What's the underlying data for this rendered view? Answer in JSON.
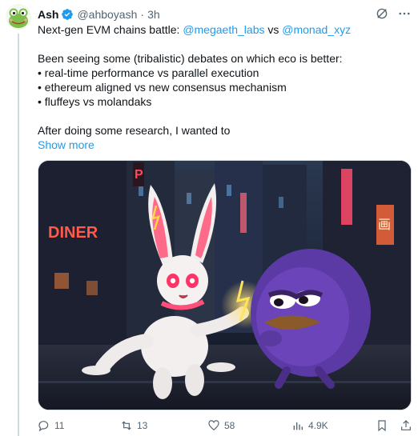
{
  "author": {
    "name": "Ash",
    "handle": "@ahboyash",
    "separator": "·",
    "time": "3h"
  },
  "tweet": {
    "line1_prefix": "Next-gen EVM chains battle: ",
    "mention1": "@megaeth_labs",
    "line1_mid": " vs ",
    "mention2": "@monad_xyz",
    "line2": "Been seeing some (tribalistic) debates on which eco is better:",
    "bullets": [
      "• real-time performance vs parallel execution",
      "• ethereum aligned vs new consensus mechanism",
      "• fluffeys vs molandaks"
    ],
    "line3": "After doing some research, I wanted to",
    "show_more": "Show more"
  },
  "media": {
    "sign_diner": "DINER",
    "sign_right": "画",
    "sign_left_top": "P"
  },
  "actions": {
    "replies": "11",
    "reposts": "13",
    "likes": "58",
    "views": "4.9K"
  },
  "colors": {
    "link": "#1d9bf0",
    "muted": "#536471",
    "verified": "#1d9bf0"
  },
  "icons": {
    "grok": "grok-icon",
    "more": "more-icon",
    "reply": "reply-icon",
    "repost": "repost-icon",
    "like": "like-icon",
    "views": "views-icon",
    "bookmark": "bookmark-icon",
    "share": "share-icon"
  }
}
